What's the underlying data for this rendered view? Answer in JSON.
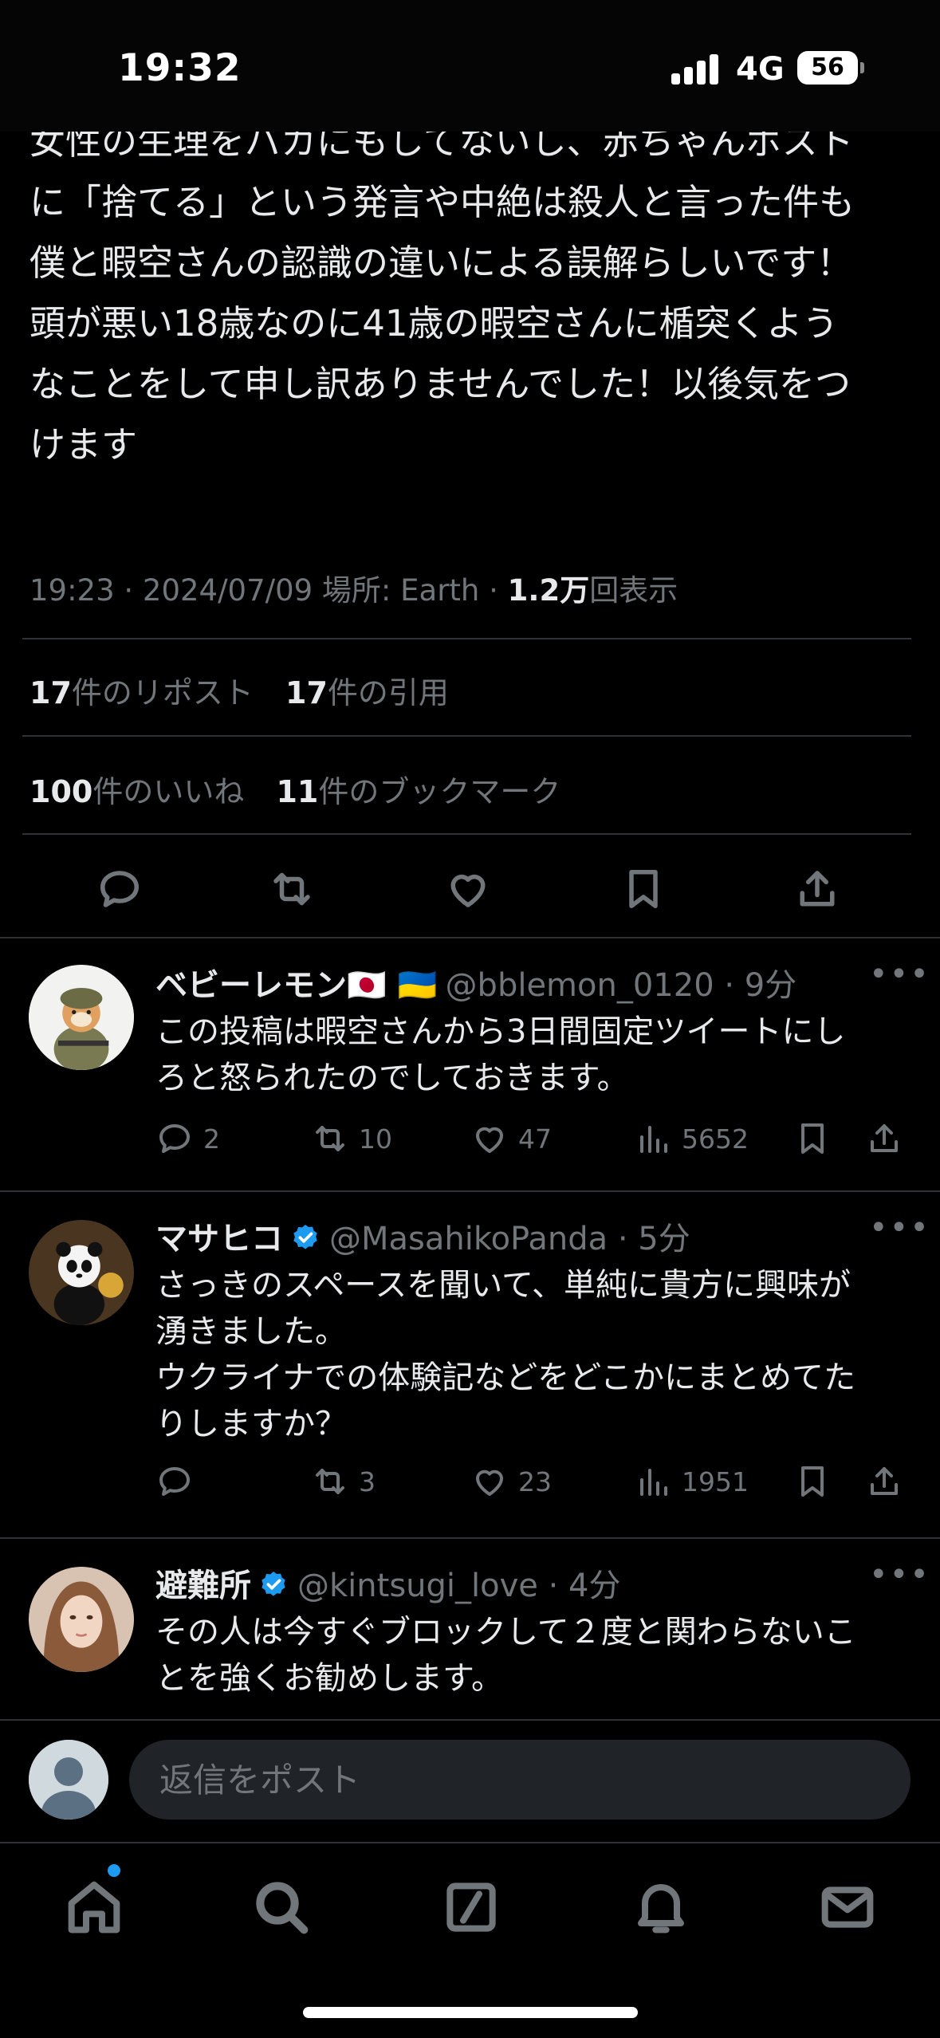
{
  "status_bar": {
    "time": "19:32",
    "network": "4G",
    "battery": "56"
  },
  "tweet": {
    "text": "女性の生理をバカにもしてないし、赤ちゃんポスト\nに「捨てる」という発言や中絶は殺人と言った件も\n僕と暇空さんの認識の違いによる誤解らしいです！\n頭が悪い18歳なのに41歳の暇空さんに楯突くよう\nなことをして申し訳ありませんでした！以後気をつ\nけます",
    "meta_prefix": "19:23 · 2024/07/09 場所: Earth · ",
    "views_count": "1.2万",
    "views_label": "回表示",
    "reposts_count": "17",
    "reposts_label": "件のリポスト",
    "quotes_count": "17",
    "quotes_label": "件の引用",
    "likes_count": "100",
    "likes_label": "件のいいね",
    "bookmarks_count": "11",
    "bookmarks_label": "件のブックマーク"
  },
  "replies": [
    {
      "name": "ベビーレモン🇯🇵 🇺🇦",
      "handle": "@bblemon_0120 · 9分",
      "text": "この投稿は暇空さんから3日間固定ツイートにし\nろと怒られたのでしておきます。",
      "reply_count": "2",
      "repost_count": "10",
      "like_count": "47",
      "view_count": "5652"
    },
    {
      "name": "マサヒコ",
      "handle": "@MasahikoPanda · 5分",
      "text": "さっきのスペースを聞いて、単純に貴方に興味が\n湧きました。\nウクライナでの体験記などをどこかにまとめてた\nりしますか？",
      "reply_count": "",
      "repost_count": "3",
      "like_count": "23",
      "view_count": "1951"
    },
    {
      "name": "避難所",
      "handle": "@kintsugi_love · 4分",
      "text": "その人は今すぐブロックして２度と関わらないこ\nとを強くお勧めします。"
    }
  ],
  "composer": {
    "placeholder": "返信をポスト"
  },
  "colors": {
    "accent": "#1d9bf0",
    "muted": "#71767b",
    "text": "#e7e9ea",
    "background": "#000000"
  }
}
